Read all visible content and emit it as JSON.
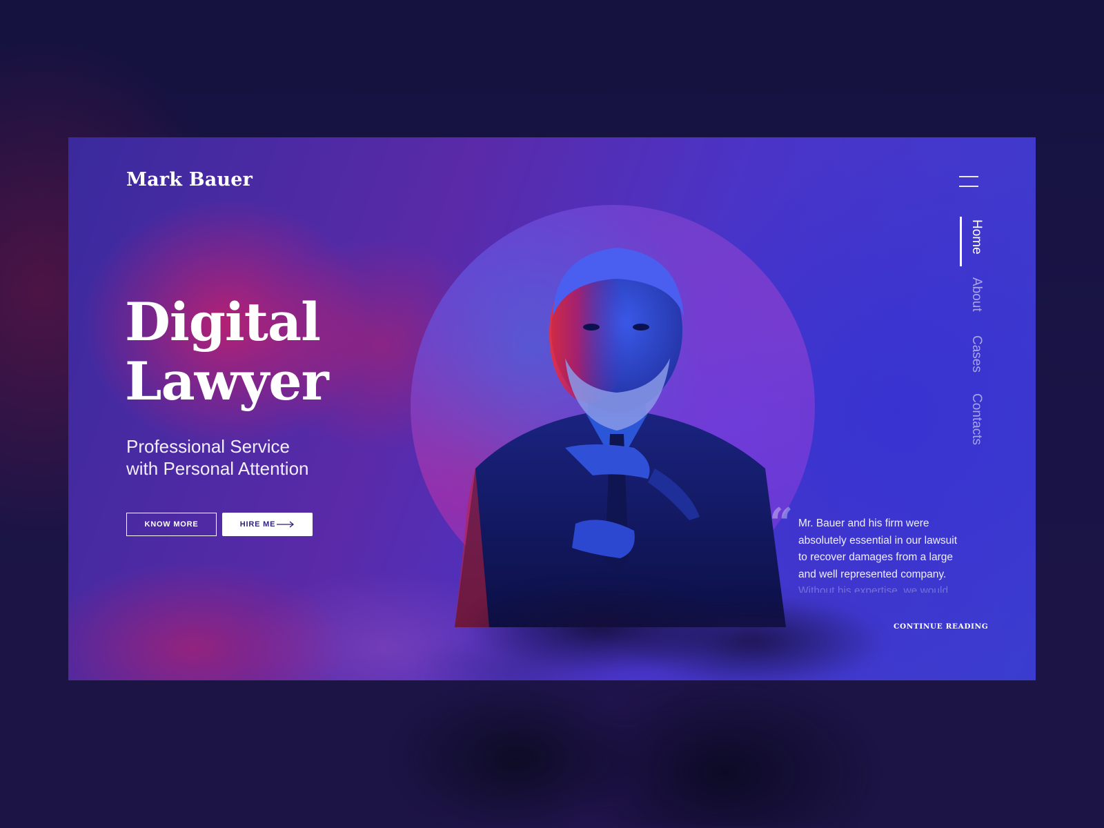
{
  "header": {
    "brand": "Mark Bauer"
  },
  "hero": {
    "title_line1": "Digital",
    "title_line2": "Lawyer",
    "subtitle_line1": "Professional Service",
    "subtitle_line2": "with Personal Attention",
    "know_more_label": "KNOW MORE",
    "hire_me_label": "HIRE ME"
  },
  "nav": {
    "items": [
      {
        "label": "Home",
        "active": true
      },
      {
        "label": "About",
        "active": false
      },
      {
        "label": "Cases",
        "active": false
      },
      {
        "label": "Contacts",
        "active": false
      }
    ],
    "menu_icon": "hamburger-icon"
  },
  "testimonial": {
    "quote_mark": "“",
    "lines": [
      "Mr. Bauer and his firm were",
      "absolutely essential in our lawsuit",
      "to recover damages from a large",
      "and well represented company.",
      "Without his expertise, we would"
    ],
    "continue_label": "CONTINUE READING"
  },
  "colors": {
    "page_bg": "#1a1446",
    "card_blue": "#3a3cd0",
    "card_purple": "#5a2aa8",
    "accent_magenta": "#d61e64",
    "button_text": "#2a1f7a"
  }
}
